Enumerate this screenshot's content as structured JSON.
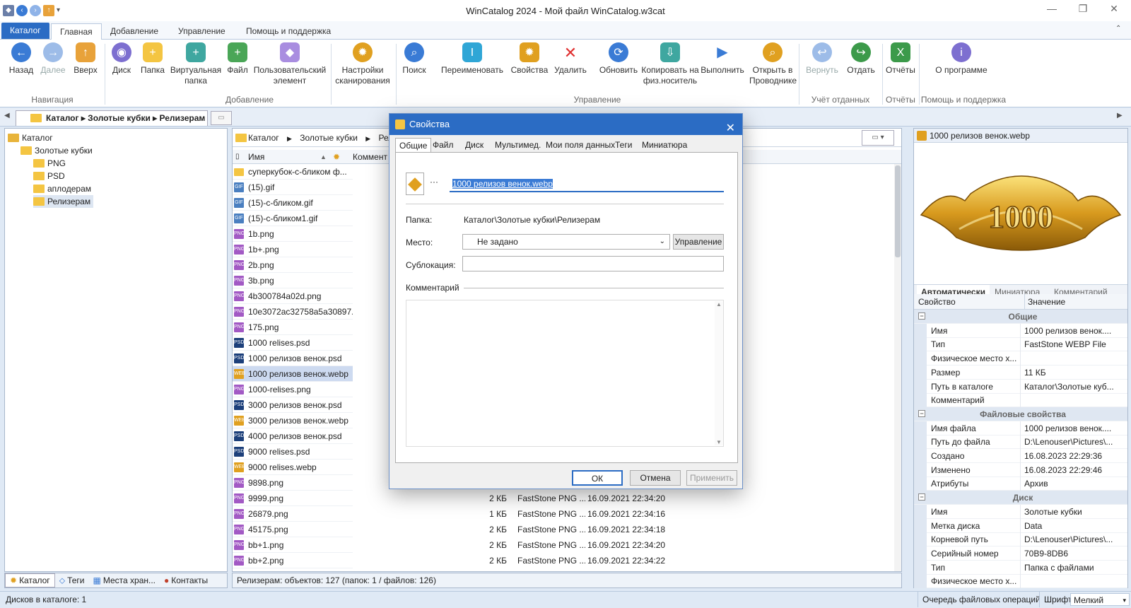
{
  "window": {
    "title": "WinCatalog 2024 - Мой файл WinCatalog.w3cat"
  },
  "ribbon_tabs": [
    "Каталог",
    "Главная",
    "Добавление",
    "Управление",
    "Помощь и поддержка"
  ],
  "ribbon": {
    "buttons": [
      "Назад",
      "Далее",
      "Вверх",
      "Диск",
      "Папка",
      "Виртуальная папка",
      "Файл",
      "Пользовательский элемент",
      "Настройки сканирования",
      "Поиск",
      "Переименовать",
      "Свойства",
      "Удалить",
      "Обновить",
      "Копировать на физ.носитель",
      "Выполнить",
      "Открыть в Проводнике",
      "Вернуть",
      "Отдать",
      "Отчёты",
      "О программе"
    ],
    "groups": [
      "Навигация",
      "Добавление",
      "Управление",
      "Учёт отданных",
      "Отчёты",
      "Помощь и поддержка"
    ]
  },
  "left_tab": "Каталог ▸ Золотые кубки ▸ Релизерам",
  "tree": [
    "Каталог",
    "Золотые кубки",
    "PNG",
    "PSD",
    "аплодерам",
    "Релизерам"
  ],
  "left_bottom_tabs": [
    "Каталог",
    "Теги",
    "Места хран...",
    "Контакты"
  ],
  "list": {
    "breadcrumb": [
      "Каталог",
      "Золотые кубки",
      "Рели"
    ],
    "columns": {
      "name": "Имя",
      "comment": "Коммент"
    },
    "rows": [
      {
        "name": "суперкубок-с-бликом ф...",
        "ft": "folder",
        "size": "",
        "type": "",
        "date": ""
      },
      {
        "name": "(15).gif",
        "ft": "gif",
        "size": "",
        "type": "",
        "date": ""
      },
      {
        "name": "(15)-с-бликом.gif",
        "ft": "gif",
        "size": "",
        "type": "",
        "date": ""
      },
      {
        "name": "(15)-с-бликом1.gif",
        "ft": "gif",
        "size": "",
        "type": "",
        "date": ""
      },
      {
        "name": "1b.png",
        "ft": "png",
        "size": "",
        "type": "",
        "date": ""
      },
      {
        "name": "1b+.png",
        "ft": "png",
        "size": "",
        "type": "",
        "date": ""
      },
      {
        "name": "2b.png",
        "ft": "png",
        "size": "",
        "type": "",
        "date": ""
      },
      {
        "name": "3b.png",
        "ft": "png",
        "size": "",
        "type": "",
        "date": ""
      },
      {
        "name": "4b300784a02d.png",
        "ft": "png",
        "size": "",
        "type": "",
        "date": ""
      },
      {
        "name": "10e3072ac32758a5a30897...",
        "ft": "png",
        "size": "",
        "type": "",
        "date": ""
      },
      {
        "name": "175.png",
        "ft": "png",
        "size": "",
        "type": "",
        "date": ""
      },
      {
        "name": "1000 relises.psd",
        "ft": "psd",
        "size": "",
        "type": "",
        "date": ""
      },
      {
        "name": "1000 релизов венок.psd",
        "ft": "psd",
        "size": "",
        "type": "",
        "date": ""
      },
      {
        "name": "1000 релизов венок.webp",
        "ft": "webp",
        "size": "",
        "type": "",
        "date": ""
      },
      {
        "name": "1000-relises.png",
        "ft": "png",
        "size": "",
        "type": "",
        "date": ""
      },
      {
        "name": "3000 релизов венок.psd",
        "ft": "psd",
        "size": "",
        "type": "",
        "date": ""
      },
      {
        "name": "3000 релизов венок.webp",
        "ft": "webp",
        "size": "",
        "type": "",
        "date": ""
      },
      {
        "name": "4000 релизов венок.psd",
        "ft": "psd",
        "size": "",
        "type": "",
        "date": ""
      },
      {
        "name": "9000 relises.psd",
        "ft": "psd",
        "size": "",
        "type": "",
        "date": ""
      },
      {
        "name": "9000 relises.webp",
        "ft": "webp",
        "size": "",
        "type": "",
        "date": ""
      },
      {
        "name": "9898.png",
        "ft": "png",
        "size": "",
        "type": "",
        "date": ""
      },
      {
        "name": "9999.png",
        "ft": "png",
        "size": "2 КБ",
        "type": "FastStone PNG ...",
        "date": "16.09.2021 22:34:20"
      },
      {
        "name": "26879.png",
        "ft": "png",
        "size": "1 КБ",
        "type": "FastStone PNG ...",
        "date": "16.09.2021 22:34:16"
      },
      {
        "name": "45175.png",
        "ft": "png",
        "size": "2 КБ",
        "type": "FastStone PNG ...",
        "date": "16.09.2021 22:34:18"
      },
      {
        "name": "bb+1.png",
        "ft": "png",
        "size": "2 КБ",
        "type": "FastStone PNG ...",
        "date": "16.09.2021 22:34:20"
      },
      {
        "name": "bb+2.png",
        "ft": "png",
        "size": "2 КБ",
        "type": "FastStone PNG ...",
        "date": "16.09.2021 22:34:22"
      }
    ],
    "status": "Релизерам: объектов: 127 (папок: 1 / файлов: 126)"
  },
  "preview": {
    "title": "1000 релизов венок.webp",
    "image_text": "1000",
    "tabs": [
      "Автоматически",
      "Миниатюра",
      "Комментарий"
    ]
  },
  "props": {
    "header": {
      "key": "Свойство",
      "value": "Значение"
    },
    "rows": [
      {
        "group": true,
        "k": "Общие",
        "v": ""
      },
      {
        "group": false,
        "k": "Имя",
        "v": "1000 релизов венок...."
      },
      {
        "group": false,
        "k": "Тип",
        "v": "FastStone WEBP File"
      },
      {
        "group": false,
        "k": "Физическое место х...",
        "v": ""
      },
      {
        "group": false,
        "k": "Размер",
        "v": "11 КБ"
      },
      {
        "group": false,
        "k": "Путь в каталоге",
        "v": "Каталог\\Золотые куб..."
      },
      {
        "group": false,
        "k": "Комментарий",
        "v": ""
      },
      {
        "group": true,
        "k": "Файловые свойства",
        "v": ""
      },
      {
        "group": false,
        "k": "Имя файла",
        "v": "1000 релизов венок...."
      },
      {
        "group": false,
        "k": "Путь до файла",
        "v": "D:\\Lenouser\\Pictures\\..."
      },
      {
        "group": false,
        "k": "Создано",
        "v": "16.08.2023 22:29:36"
      },
      {
        "group": false,
        "k": "Изменено",
        "v": "16.08.2023 22:29:46"
      },
      {
        "group": false,
        "k": "Атрибуты",
        "v": "Архив"
      },
      {
        "group": true,
        "k": "Диск",
        "v": ""
      },
      {
        "group": false,
        "k": "Имя",
        "v": "Золотые кубки"
      },
      {
        "group": false,
        "k": "Метка диска",
        "v": "Data"
      },
      {
        "group": false,
        "k": "Корневой путь",
        "v": "D:\\Lenouser\\Pictures\\..."
      },
      {
        "group": false,
        "k": "Серийный номер",
        "v": "70B9-8DB6"
      },
      {
        "group": false,
        "k": "Тип",
        "v": "Папка с файлами"
      },
      {
        "group": false,
        "k": "Физическое место х...",
        "v": ""
      }
    ]
  },
  "dialog": {
    "title": "Свойства",
    "tabs": [
      "Общие",
      "Файл",
      "Диск",
      "Мультимед.",
      "Мои поля данных",
      "Теги",
      "Миниатюра"
    ],
    "ellipsis": "···",
    "name_value": "1000 релизов венок.webp",
    "folder_label": "Папка:",
    "folder_value": "Каталог\\Золотые кубки\\Релизерам",
    "place_label": "Место:",
    "place_value": "Не задано",
    "manage_button": "Управление",
    "sublocation_label": "Сублокация:",
    "sublocation_value": "",
    "comment_label": "Комментарий",
    "comment_value": "",
    "ok": "ОК",
    "cancel": "Отмена",
    "apply": "Применить"
  },
  "statusbar": {
    "left": "Дисков в каталоге: 1",
    "queue": "Очередь файловых операций",
    "font_label": "Шрифт:",
    "font_value": "Мелкий"
  },
  "colors": {
    "accent": "#2b6cc4",
    "folder": "#f4c542",
    "png": "#a259c4",
    "gif": "#4a7fc0",
    "psd": "#1c3f7a",
    "webp": "#e0a020"
  }
}
